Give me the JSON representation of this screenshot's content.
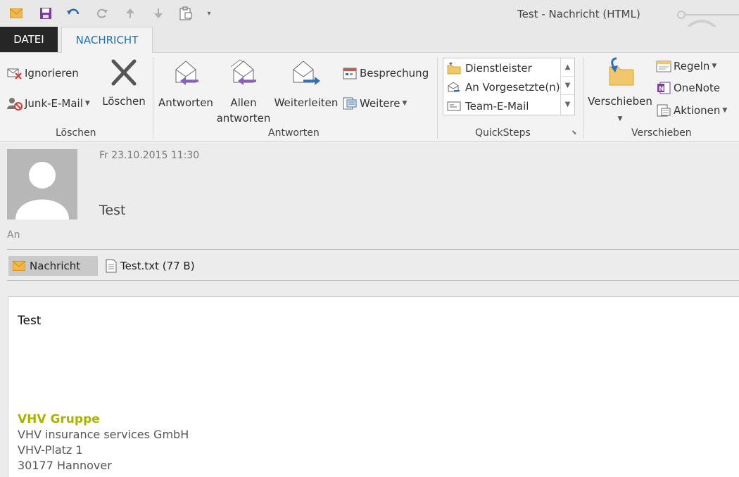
{
  "window": {
    "title": "Test - Nachricht (HTML)"
  },
  "quick_access": {
    "icons": [
      "envelope-icon",
      "save-icon",
      "undo-icon",
      "redo-icon",
      "arrow-up-icon",
      "arrow-down-icon",
      "clipboard-icon",
      "customize-dropdown-icon"
    ]
  },
  "tabs": {
    "file": "DATEI",
    "message": "NACHRICHT"
  },
  "ribbon": {
    "delete_group": {
      "label": "Löschen",
      "ignore": "Ignorieren",
      "junk": "Junk-E-Mail",
      "delete": "Löschen"
    },
    "respond_group": {
      "label": "Antworten",
      "reply": "Antworten",
      "reply_all_line1": "Allen",
      "reply_all_line2": "antworten",
      "forward": "Weiterleiten",
      "meeting": "Besprechung",
      "more": "Weitere"
    },
    "quicksteps_group": {
      "label": "QuickSteps",
      "items": [
        "Dienstleister",
        "An Vorgesetzte(n)",
        "Team-E-Mail"
      ]
    },
    "move_group": {
      "label": "Verschieben",
      "move": "Verschieben",
      "rules": "Regeln",
      "onenote": "OneNote",
      "actions": "Aktionen"
    }
  },
  "message": {
    "date": "Fr 23.10.2015 11:30",
    "subject": "Test",
    "to_label": "An",
    "attachments": {
      "message_tab": "Nachricht",
      "file": "Test.txt (77 B)"
    },
    "body": "Test",
    "signature": {
      "company": "VHV Gruppe",
      "lines": [
        "VHV insurance services GmbH",
        "VHV-Platz 1",
        "30177 Hannover"
      ]
    }
  },
  "colors": {
    "accent_blue": "#1e6fb5",
    "file_tab_bg": "#262626",
    "signature_green": "#a8b400",
    "reply_arrow_purple": "#8a5fbf",
    "forward_arrow_blue": "#2e6fc0"
  }
}
